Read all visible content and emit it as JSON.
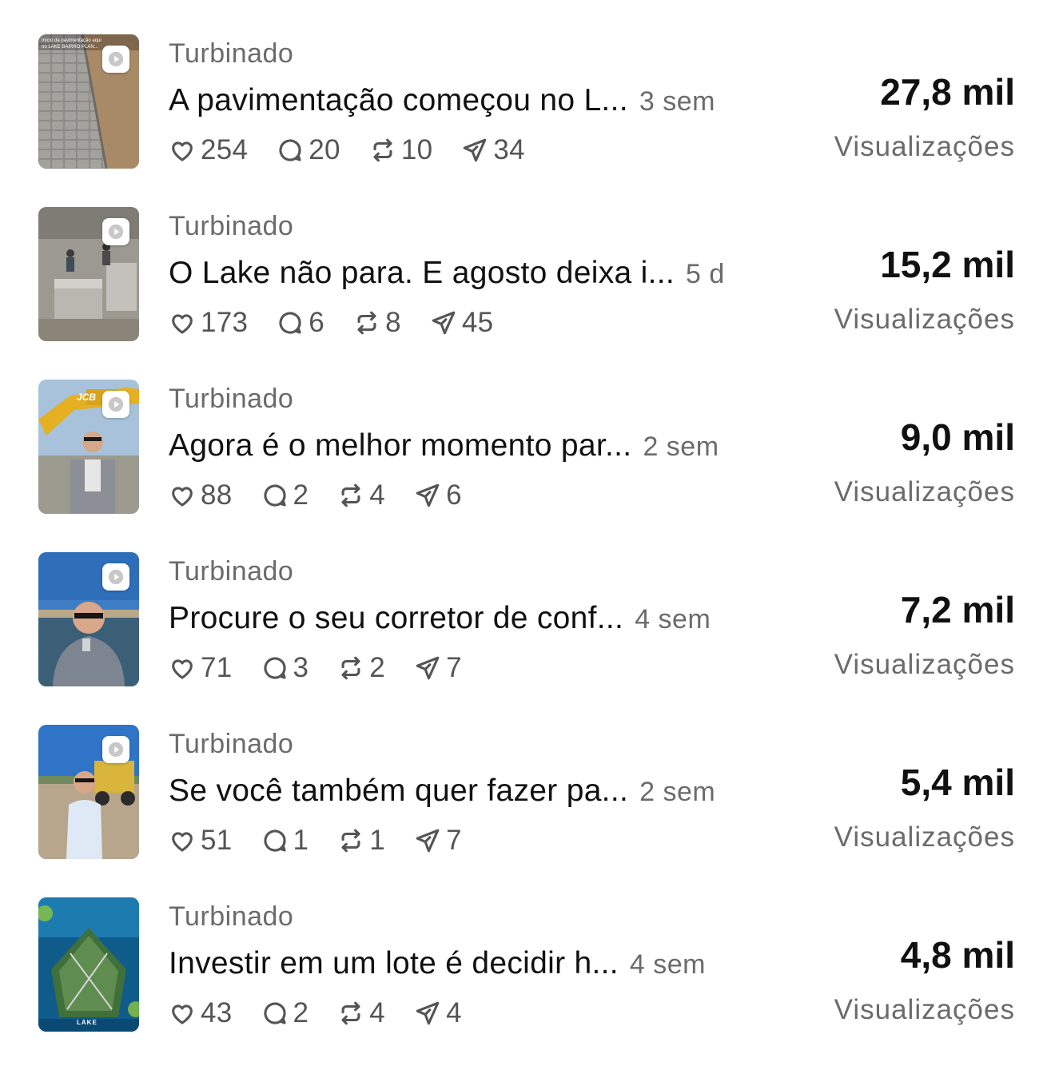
{
  "posts": [
    {
      "status": "Turbinado",
      "caption": "A pavimentação começou no L...",
      "age": "3 sem",
      "likes": "254",
      "comments": "20",
      "reposts": "10",
      "shares": "34",
      "views": "27,8 mil",
      "views_label": "Visualizações",
      "thumbnail_text": "Início da pavimentação aqui no LAKE BAIRRO PLAN..."
    },
    {
      "status": "Turbinado",
      "caption": "O Lake não para. E agosto deixa i...",
      "age": "5 d",
      "likes": "173",
      "comments": "6",
      "reposts": "8",
      "shares": "45",
      "views": "15,2 mil",
      "views_label": "Visualizações"
    },
    {
      "status": "Turbinado",
      "caption": "Agora é o melhor momento par...",
      "age": "2 sem",
      "likes": "88",
      "comments": "2",
      "reposts": "4",
      "shares": "6",
      "views": "9,0 mil",
      "views_label": "Visualizações",
      "thumbnail_text": "JCB"
    },
    {
      "status": "Turbinado",
      "caption": "Procure o seu corretor de conf...",
      "age": "4 sem",
      "likes": "71",
      "comments": "3",
      "reposts": "2",
      "shares": "7",
      "views": "7,2 mil",
      "views_label": "Visualizações"
    },
    {
      "status": "Turbinado",
      "caption": "Se você também quer fazer pa...",
      "age": "2 sem",
      "likes": "51",
      "comments": "1",
      "reposts": "1",
      "shares": "7",
      "views": "5,4 mil",
      "views_label": "Visualizações"
    },
    {
      "status": "Turbinado",
      "caption": "Investir em um lote é decidir h...",
      "age": "4 sem",
      "likes": "43",
      "comments": "2",
      "reposts": "4",
      "shares": "4",
      "views": "4,8 mil",
      "views_label": "Visualizações",
      "thumbnail_text": "LAKE"
    }
  ],
  "icons": {
    "like": "heart-icon",
    "comment": "comment-icon",
    "repost": "repost-icon",
    "share": "share-icon",
    "play": "play-icon"
  },
  "colors": {
    "primary_text": "#111111",
    "secondary_text": "#6b6b6b",
    "icon": "#555555"
  }
}
